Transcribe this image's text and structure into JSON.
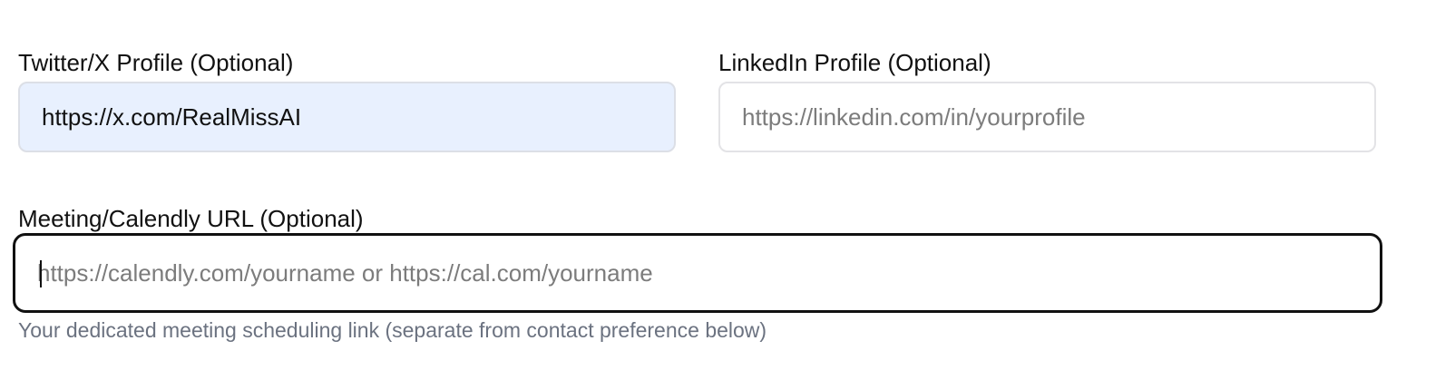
{
  "twitter": {
    "label": "Twitter/X Profile (Optional)",
    "value": "https://x.com/RealMissAI",
    "placeholder": ""
  },
  "linkedin": {
    "label": "LinkedIn Profile (Optional)",
    "value": "",
    "placeholder": "https://linkedin.com/in/yourprofile"
  },
  "meeting": {
    "label": "Meeting/Calendly URL (Optional)",
    "value": "",
    "placeholder": "https://calendly.com/yourname or https://cal.com/yourname",
    "help": "Your dedicated meeting scheduling link (separate from contact preference below)"
  }
}
